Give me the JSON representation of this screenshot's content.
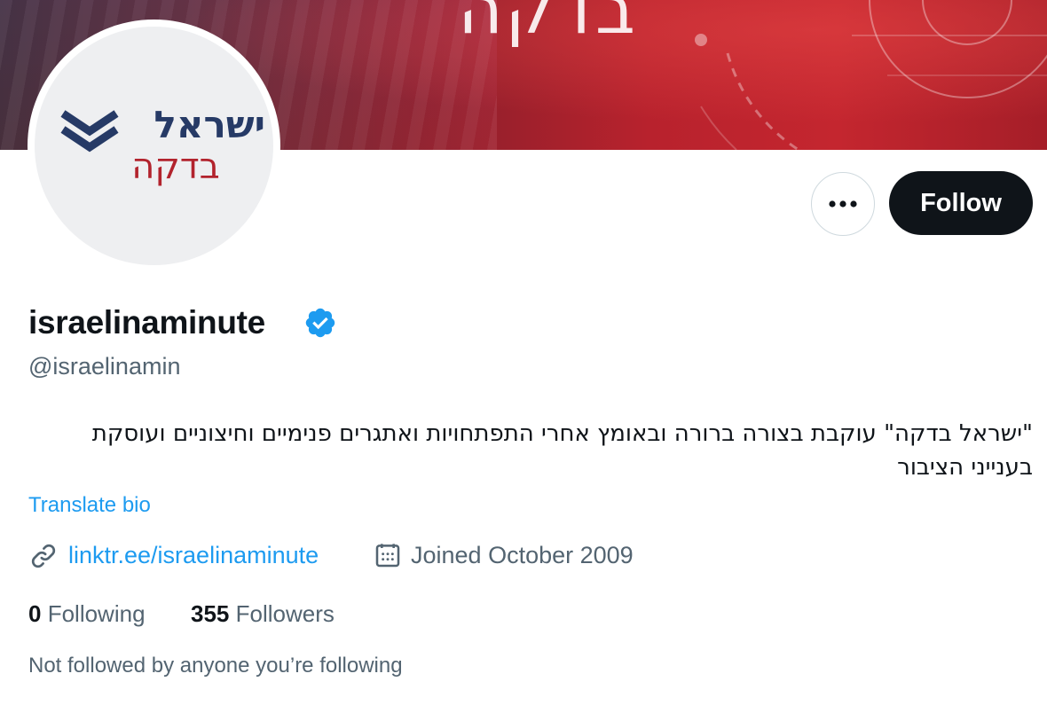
{
  "banner": {
    "title_text": "בדקה"
  },
  "avatar": {
    "logo_line1": "ישראל",
    "logo_line2": "בדקה",
    "logo_colors": {
      "navy": "#263a66",
      "red": "#b2232d"
    }
  },
  "actions": {
    "more_icon": "ellipsis-icon",
    "follow_label": "Follow"
  },
  "profile": {
    "display_name": "israelinaminute",
    "verified_icon": "verified-badge-icon",
    "handle": "@israelinamin",
    "bio": "\"ישראל בדקה\" עוקבת בצורה ברורה ובאומץ אחרי התפתחויות ואתגרים פנימיים וחיצוניים ועוסקת בענייני הציבור",
    "translate_label": "Translate bio",
    "website_icon": "link-icon",
    "website": "linktr.ee/israelinaminute",
    "joined_icon": "calendar-icon",
    "joined": "Joined October 2009"
  },
  "stats": {
    "following_count": "0",
    "following_label": "Following",
    "followers_count": "355",
    "followers_label": "Followers"
  },
  "followed_note": "Not followed by anyone you’re following",
  "colors": {
    "accent": "#1d9bf0",
    "text": "#0f1419",
    "secondary": "#536471",
    "follow_bg": "#0f1419"
  }
}
